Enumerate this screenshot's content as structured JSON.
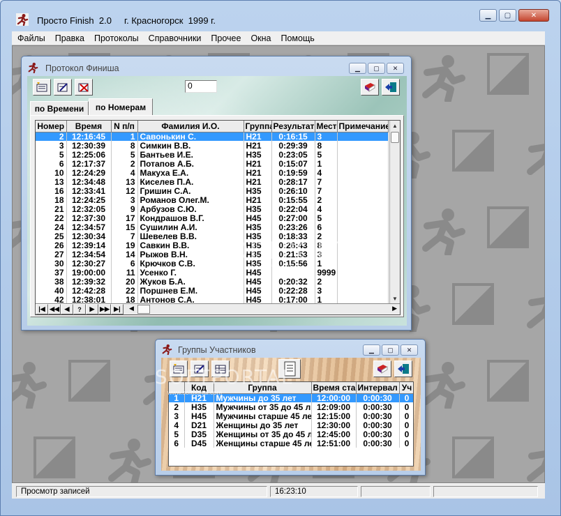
{
  "app": {
    "title": "Просто Finish  2.0     г. Красногорск  1999 г.",
    "icon": "runner-icon",
    "window_buttons": [
      "minimize",
      "maximize",
      "close"
    ]
  },
  "menu": [
    "Файлы",
    "Правка",
    "Протоколы",
    "Справочники",
    "Прочее",
    "Окна",
    "Помощь"
  ],
  "protocol_window": {
    "title": "Протокол Финиша",
    "counter_value": "0",
    "tabs": [
      {
        "label": "по Времени",
        "active": false
      },
      {
        "label": "по Номерам",
        "active": true
      }
    ],
    "columns": [
      "Номер",
      "Время",
      "N п/п",
      "Фамилия И.О.",
      "Группа",
      "Результат",
      "Место",
      "Примечание"
    ],
    "rows": [
      {
        "num": "2",
        "time": "12:16:45",
        "np": "1",
        "name": "Савонькин С.",
        "group": "H21",
        "result": "0:16:15",
        "place": "3",
        "selected": true
      },
      {
        "num": "3",
        "time": "12:30:39",
        "np": "8",
        "name": "Симкин В.В.",
        "group": "H21",
        "result": "0:29:39",
        "place": "8"
      },
      {
        "num": "5",
        "time": "12:25:06",
        "np": "5",
        "name": "Бантьев И.Е.",
        "group": "H35",
        "result": "0:23:05",
        "place": "5"
      },
      {
        "num": "6",
        "time": "12:17:37",
        "np": "2",
        "name": "Потапов А.Б.",
        "group": "H21",
        "result": "0:15:07",
        "place": "1"
      },
      {
        "num": "10",
        "time": "12:24:29",
        "np": "4",
        "name": "Макуха Е.А.",
        "group": "H21",
        "result": "0:19:59",
        "place": "4"
      },
      {
        "num": "13",
        "time": "12:34:48",
        "np": "13",
        "name": "Киселев П.А.",
        "group": "H21",
        "result": "0:28:17",
        "place": "7"
      },
      {
        "num": "16",
        "time": "12:33:41",
        "np": "12",
        "name": "Гришин С.А.",
        "group": "H35",
        "result": "0:26:10",
        "place": "7"
      },
      {
        "num": "18",
        "time": "12:24:25",
        "np": "3",
        "name": "Романов Олег.М.",
        "group": "H21",
        "result": "0:15:55",
        "place": "2"
      },
      {
        "num": "21",
        "time": "12:32:05",
        "np": "9",
        "name": "Арбузов С.Ю.",
        "group": "H35",
        "result": "0:22:04",
        "place": "4"
      },
      {
        "num": "22",
        "time": "12:37:30",
        "np": "17",
        "name": "Кондрашов В.Г.",
        "group": "H45",
        "result": "0:27:00",
        "place": "5"
      },
      {
        "num": "24",
        "time": "12:34:57",
        "np": "15",
        "name": "Сушилин А.И.",
        "group": "H35",
        "result": "0:23:26",
        "place": "6"
      },
      {
        "num": "25",
        "time": "12:30:34",
        "np": "7",
        "name": "Шевелев В.В.",
        "group": "H35",
        "result": "0:18:33",
        "place": "2"
      },
      {
        "num": "26",
        "time": "12:39:14",
        "np": "19",
        "name": "Савкин В.В.",
        "group": "H35",
        "result": "0:26:43",
        "place": "8"
      },
      {
        "num": "27",
        "time": "12:34:54",
        "np": "14",
        "name": "Рыжов В.Н.",
        "group": "H35",
        "result": "0:21:53",
        "place": "3"
      },
      {
        "num": "30",
        "time": "12:30:27",
        "np": "6",
        "name": "Крючков С.В.",
        "group": "H35",
        "result": "0:15:56",
        "place": "1"
      },
      {
        "num": "37",
        "time": "19:00:00",
        "np": "11",
        "name": "Усенко Г.",
        "group": "H45",
        "result": "",
        "place": "9999"
      },
      {
        "num": "38",
        "time": "12:39:32",
        "np": "20",
        "name": "Жуков Б.А.",
        "group": "H45",
        "result": "0:20:32",
        "place": "2"
      },
      {
        "num": "40",
        "time": "12:42:28",
        "np": "22",
        "name": "Поршнев Е.М.",
        "group": "H45",
        "result": "0:22:28",
        "place": "3"
      },
      {
        "num": "42",
        "time": "12:38:01",
        "np": "18",
        "name": "Антонов С.А.",
        "group": "H45",
        "result": "0:17:00",
        "place": "1"
      }
    ],
    "nav_buttons": [
      "|◀",
      "◀◀",
      "◀",
      "?",
      "▶",
      "▶▶",
      "▶|"
    ]
  },
  "groups_window": {
    "title": "Группы Участников",
    "columns": [
      "",
      "Код",
      "Группа",
      "Время старта",
      "Интервал",
      "Уч"
    ],
    "rows": [
      {
        "n": "1",
        "code": "H21",
        "group": "Мужчины до 35 лет",
        "start": "12:00:00",
        "interval": "0:00:30",
        "u": "0",
        "selected": true
      },
      {
        "n": "2",
        "code": "H35",
        "group": "Мужчины от 35 до 45 л",
        "start": "12:09:00",
        "interval": "0:00:30",
        "u": "0"
      },
      {
        "n": "3",
        "code": "H45",
        "group": "Мужчины старше 45 ле",
        "start": "12:15:00",
        "interval": "0:00:30",
        "u": "0"
      },
      {
        "n": "4",
        "code": "D21",
        "group": "Женщины до 35 лет",
        "start": "12:30:00",
        "interval": "0:00:30",
        "u": "0"
      },
      {
        "n": "5",
        "code": "D35",
        "group": "Женщины от 35 до 45 л",
        "start": "12:45:00",
        "interval": "0:00:30",
        "u": "0"
      },
      {
        "n": "6",
        "code": "D45",
        "group": "Женщины старше 45 ле",
        "start": "12:51:00",
        "interval": "0:00:30",
        "u": "0"
      }
    ]
  },
  "status": {
    "message": "Просмотр записей",
    "time": "16:23:10"
  },
  "watermark": {
    "logo": "SOFTPORTAL",
    "url": "www.softportal.com"
  },
  "colors": {
    "selection": "#3399ff",
    "mdi_background": "#a6a6a6",
    "title_gradient": "#bcd3ee"
  }
}
